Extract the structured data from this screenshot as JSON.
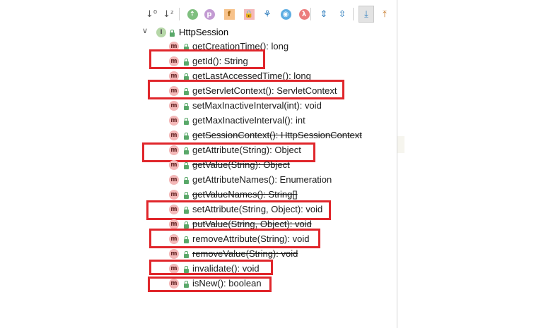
{
  "toolbar": {
    "buttons": [
      {
        "name": "sort-by-visibility-button",
        "glyph": "↓⁰"
      },
      {
        "name": "sort-alphabetically-button",
        "glyph": "↓ᶻ"
      },
      {
        "name": "show-inherited-button",
        "glyph": "⇡"
      },
      {
        "name": "show-properties-button",
        "glyph": "p"
      },
      {
        "name": "show-fields-button",
        "glyph": "f"
      },
      {
        "name": "show-non-public-button",
        "glyph": "🔒"
      },
      {
        "name": "show-anonymous-button",
        "glyph": "⚘"
      },
      {
        "name": "show-lambdas-button",
        "glyph": "◉"
      },
      {
        "name": "show-lambda-button",
        "glyph": "λ"
      },
      {
        "name": "expand-all-button",
        "glyph": "⇕"
      },
      {
        "name": "collapse-all-button",
        "glyph": "⇳"
      },
      {
        "name": "autoscroll-to-source-button",
        "glyph": "⤓"
      },
      {
        "name": "autoscroll-from-source-button",
        "glyph": "⤒"
      }
    ]
  },
  "tree": {
    "root": {
      "label": "HttpSession",
      "icon": "interface-icon"
    },
    "methods": [
      {
        "label": "getCreationTime(): long",
        "deprecated": false,
        "highlighted": false
      },
      {
        "label": "getId(): String",
        "deprecated": false,
        "highlighted": true
      },
      {
        "label": "getLastAccessedTime(): long",
        "deprecated": false,
        "highlighted": false
      },
      {
        "label": "getServletContext(): ServletContext",
        "deprecated": false,
        "highlighted": true
      },
      {
        "label": "setMaxInactiveInterval(int): void",
        "deprecated": false,
        "highlighted": false
      },
      {
        "label": "getMaxInactiveInterval(): int",
        "deprecated": false,
        "highlighted": false
      },
      {
        "label": "getSessionContext(): HttpSessionContext",
        "deprecated": true,
        "highlighted": false
      },
      {
        "label": "getAttribute(String): Object",
        "deprecated": false,
        "highlighted": true
      },
      {
        "label": "getValue(String): Object",
        "deprecated": true,
        "highlighted": false
      },
      {
        "label": "getAttributeNames(): Enumeration",
        "deprecated": false,
        "highlighted": false
      },
      {
        "label": "getValueNames(): String[]",
        "deprecated": true,
        "highlighted": false
      },
      {
        "label": "setAttribute(String, Object): void",
        "deprecated": false,
        "highlighted": true
      },
      {
        "label": "putValue(String, Object): void",
        "deprecated": true,
        "highlighted": false
      },
      {
        "label": "removeAttribute(String): void",
        "deprecated": false,
        "highlighted": true
      },
      {
        "label": "removeValue(String): void",
        "deprecated": true,
        "highlighted": false
      },
      {
        "label": "invalidate(): void",
        "deprecated": false,
        "highlighted": true
      },
      {
        "label": "isNew(): boolean",
        "deprecated": false,
        "highlighted": true
      }
    ],
    "method_icon_letter": "m",
    "interface_icon_letter": "I"
  },
  "colors": {
    "highlight_box": "#e0262b",
    "method_icon_bg": "#f4b8b8",
    "interface_icon_bg": "#b6d7a8",
    "lock_green": "#59a869"
  }
}
